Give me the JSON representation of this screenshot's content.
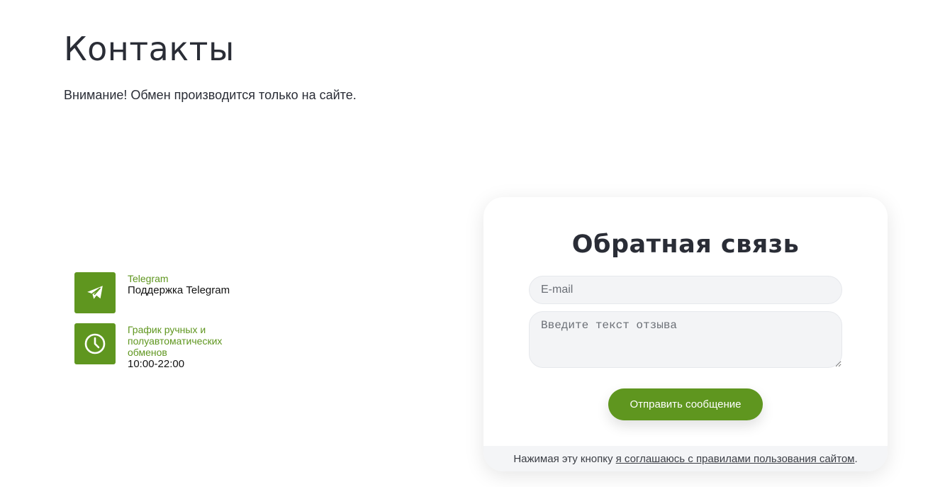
{
  "page": {
    "title": "Контакты",
    "notice": "Внимание! Обмен производится только на сайте."
  },
  "contacts": [
    {
      "icon": "telegram-plane-icon",
      "label": "Telegram",
      "value": "Поддержка Telegram"
    },
    {
      "icon": "clock-icon",
      "label": "График ручных и полуавтоматических обменов",
      "value": "10:00-22:00"
    }
  ],
  "feedback": {
    "title": "Обратная связь",
    "email_placeholder": "E-mail",
    "email_value": "",
    "message_placeholder": "Введите текст отзыва",
    "message_value": "",
    "submit_label": "Отправить сообщение",
    "footer_prefix": "Нажимая эту кнопку",
    "footer_link": "я соглашаюсь с правилами пользования сайтом",
    "footer_suffix": "."
  },
  "colors": {
    "accent": "#5f961f",
    "text": "#2a2d36",
    "input_bg": "#f3f4f6"
  }
}
